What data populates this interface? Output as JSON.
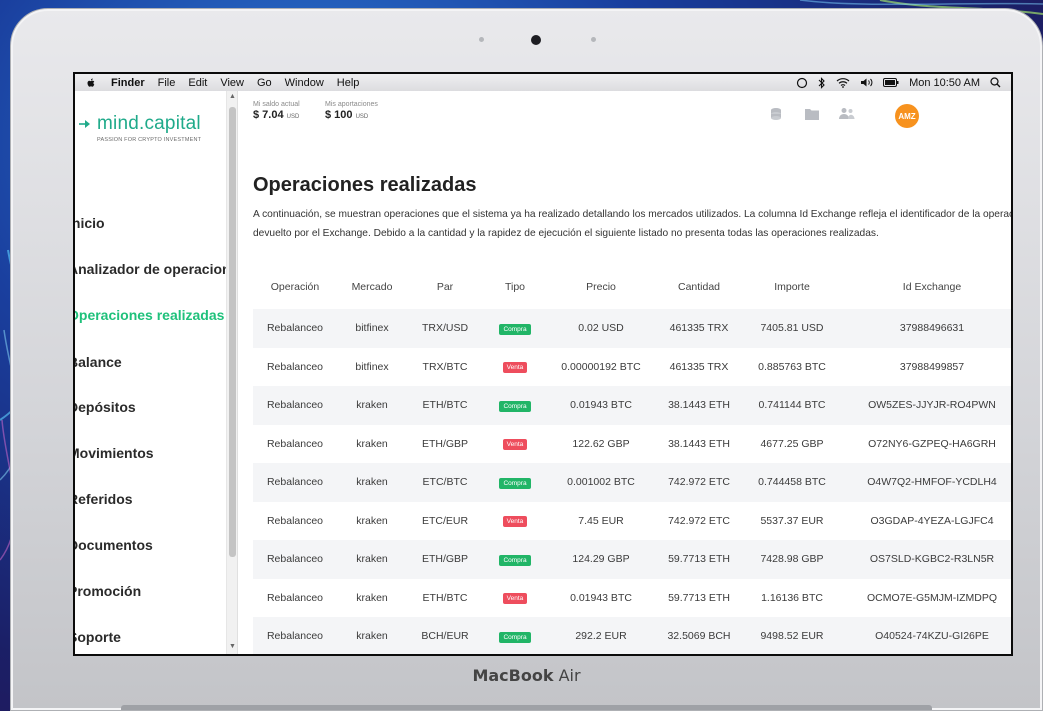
{
  "hardware": {
    "brand_bold": "MacBook",
    "brand_light": " Air"
  },
  "menubar": {
    "app_name": "Finder",
    "items": [
      "File",
      "Edit",
      "View",
      "Go",
      "Window",
      "Help"
    ],
    "clock": "Mon 10:50 AM"
  },
  "logo": {
    "name": "mind.capital",
    "tagline": "PASSION FOR CRYPTO INVESTMENT"
  },
  "sidebar": {
    "items": [
      {
        "label": "Inicio",
        "active": false
      },
      {
        "label": "Analizador de operaciones",
        "active": false
      },
      {
        "label": "Operaciones realizadas",
        "active": true
      },
      {
        "label": "Balance",
        "active": false
      },
      {
        "label": "Depósitos",
        "active": false
      },
      {
        "label": "Movimientos",
        "active": false
      },
      {
        "label": "Referidos",
        "active": false
      },
      {
        "label": "Documentos",
        "active": false
      },
      {
        "label": "Promoción",
        "active": false
      },
      {
        "label": "Soporte",
        "active": false
      }
    ]
  },
  "topbar": {
    "balance_label": "Mi saldo actual",
    "balance_value": "$ 7.04",
    "balance_unit": "USD",
    "contrib_label": "Mis aportaciones",
    "contrib_value": "$ 100",
    "contrib_unit": "USD",
    "avatar_initials": "AMZ"
  },
  "page": {
    "title": "Operaciones realizadas",
    "description": "A continuación, se muestran operaciones que el sistema ya ha realizado detallando los mercados utilizados. La columna Id Exchange refleja el identificador de la operación devuelto por el Exchange. Debido a la cantidad y la rapidez de ejecución el siguiente listado no presenta todas las operaciones realizadas."
  },
  "table": {
    "columns": [
      "Operación",
      "Mercado",
      "Par",
      "Tipo",
      "Precio",
      "Cantidad",
      "Importe",
      "Id Exchange"
    ],
    "rows": [
      {
        "operacion": "Rebalanceo",
        "mercado": "bitfinex",
        "par": "TRX/USD",
        "tipo": "Compra",
        "precio": "0.02 USD",
        "cantidad": "461335 TRX",
        "importe": "7405.81 USD",
        "id": "37988496631"
      },
      {
        "operacion": "Rebalanceo",
        "mercado": "bitfinex",
        "par": "TRX/BTC",
        "tipo": "Venta",
        "precio": "0.00000192 BTC",
        "cantidad": "461335 TRX",
        "importe": "0.885763 BTC",
        "id": "37988499857"
      },
      {
        "operacion": "Rebalanceo",
        "mercado": "kraken",
        "par": "ETH/BTC",
        "tipo": "Compra",
        "precio": "0.01943 BTC",
        "cantidad": "38.1443 ETH",
        "importe": "0.741144 BTC",
        "id": "OW5ZES-JJYJR-RO4PWN"
      },
      {
        "operacion": "Rebalanceo",
        "mercado": "kraken",
        "par": "ETH/GBP",
        "tipo": "Venta",
        "precio": "122.62 GBP",
        "cantidad": "38.1443 ETH",
        "importe": "4677.25 GBP",
        "id": "O72NY6-GZPEQ-HA6GRH"
      },
      {
        "operacion": "Rebalanceo",
        "mercado": "kraken",
        "par": "ETC/BTC",
        "tipo": "Compra",
        "precio": "0.001002 BTC",
        "cantidad": "742.972 ETC",
        "importe": "0.744458 BTC",
        "id": "O4W7Q2-HMFOF-YCDLH4"
      },
      {
        "operacion": "Rebalanceo",
        "mercado": "kraken",
        "par": "ETC/EUR",
        "tipo": "Venta",
        "precio": "7.45 EUR",
        "cantidad": "742.972 ETC",
        "importe": "5537.37 EUR",
        "id": "O3GDAP-4YEZA-LGJFC4"
      },
      {
        "operacion": "Rebalanceo",
        "mercado": "kraken",
        "par": "ETH/GBP",
        "tipo": "Compra",
        "precio": "124.29 GBP",
        "cantidad": "59.7713 ETH",
        "importe": "7428.98 GBP",
        "id": "OS7SLD-KGBC2-R3LN5R"
      },
      {
        "operacion": "Rebalanceo",
        "mercado": "kraken",
        "par": "ETH/BTC",
        "tipo": "Venta",
        "precio": "0.01943 BTC",
        "cantidad": "59.7713 ETH",
        "importe": "1.16136 BTC",
        "id": "OCMO7E-G5MJM-IZMDPQ"
      },
      {
        "operacion": "Rebalanceo",
        "mercado": "kraken",
        "par": "BCH/EUR",
        "tipo": "Compra",
        "precio": "292.2 EUR",
        "cantidad": "32.5069 BCH",
        "importe": "9498.52 EUR",
        "id": "O40524-74KZU-GI26PE"
      }
    ]
  },
  "icons": {
    "apple": "apple-logo-icon",
    "topbar": [
      "coins-icon",
      "folder-icon",
      "users-icon"
    ],
    "status": [
      "siri-icon",
      "bluetooth-icon",
      "wifi-icon",
      "volume-icon",
      "battery-icon",
      "search-icon"
    ]
  },
  "colors": {
    "brand": "#1faa8a",
    "active_nav": "#1fc17b",
    "buy": "#21b567",
    "sell": "#ee4d5d",
    "avatar": "#f7921e"
  }
}
